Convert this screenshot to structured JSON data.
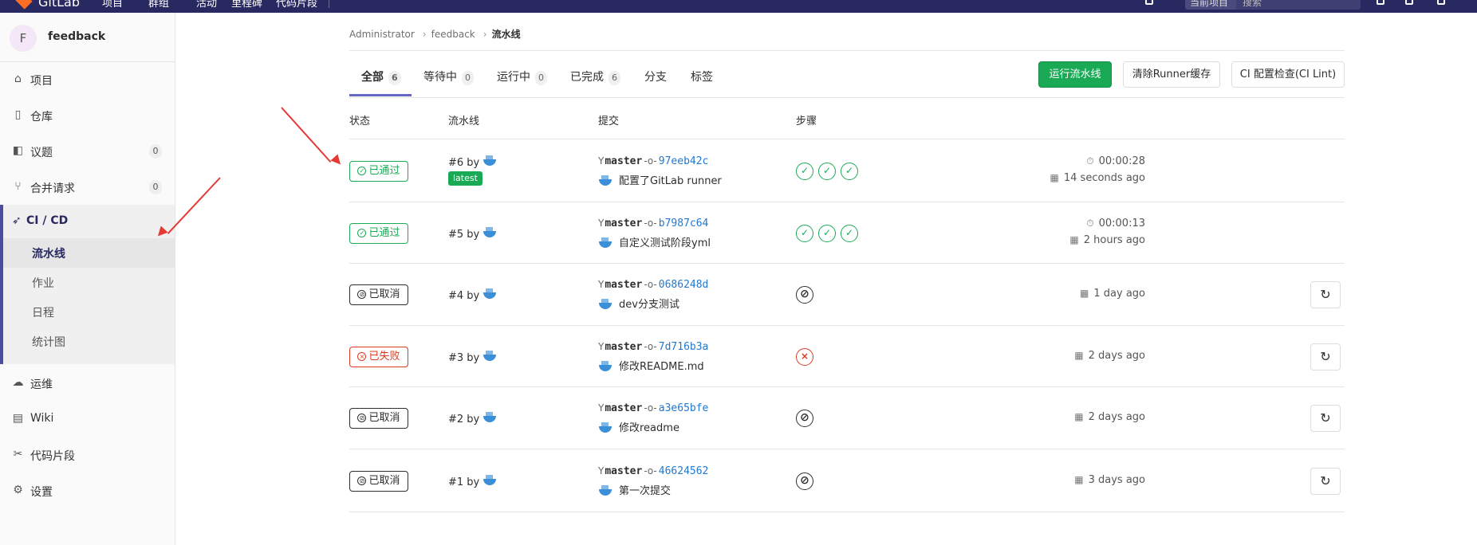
{
  "topbar": {
    "brand": "GitLab",
    "nav": [
      "项目",
      "群组",
      "活动",
      "里程碑",
      "代码片段"
    ],
    "scope": "当前项目",
    "search_placeholder": "搜索"
  },
  "sidebar": {
    "project_avatar": "F",
    "project_name": "feedback",
    "items": [
      {
        "label": "项目",
        "icon": "home-icon",
        "glyph": "⌂"
      },
      {
        "label": "仓库",
        "icon": "book-icon",
        "glyph": "▯"
      },
      {
        "label": "议题",
        "icon": "issues-icon",
        "glyph": "◧",
        "count": "0"
      },
      {
        "label": "合并请求",
        "icon": "merge-request-icon",
        "glyph": "⑂",
        "count": "0"
      },
      {
        "label": "运维",
        "icon": "cloud-icon",
        "glyph": "☁"
      },
      {
        "label": "Wiki",
        "icon": "wiki-icon",
        "glyph": "▤"
      },
      {
        "label": "代码片段",
        "icon": "snippet-icon",
        "glyph": "✂"
      },
      {
        "label": "设置",
        "icon": "settings-icon",
        "glyph": "⚙"
      }
    ],
    "cicd": {
      "label": "CI / CD",
      "glyph": "🚀",
      "sub": [
        "流水线",
        "作业",
        "日程",
        "统计图"
      ]
    }
  },
  "breadcrumb": [
    "Administrator",
    "feedback",
    "流水线"
  ],
  "tabs": [
    {
      "label": "全部",
      "count": "6"
    },
    {
      "label": "等待中",
      "count": "0"
    },
    {
      "label": "运行中",
      "count": "0"
    },
    {
      "label": "已完成",
      "count": "6"
    },
    {
      "label": "分支"
    },
    {
      "label": "标签"
    }
  ],
  "buttons": {
    "run_pipeline": "运行流水线",
    "clear_cache": "清除Runner缓存",
    "ci_lint": "CI 配置检查(CI Lint)"
  },
  "table_headers": [
    "状态",
    "流水线",
    "提交",
    "步骤"
  ],
  "pipelines": [
    {
      "status": "已通过",
      "kind": "passed",
      "id": "#6 by",
      "latest": "latest",
      "branch": "master",
      "sha": "97eeb42c",
      "message": "配置了GitLab runner",
      "stages": [
        "ok",
        "ok",
        "ok"
      ],
      "duration": "00:00:28",
      "finished": "14 seconds ago"
    },
    {
      "status": "已通过",
      "kind": "passed",
      "id": "#5 by",
      "branch": "master",
      "sha": "b7987c64",
      "message": "自定义测试阶段yml",
      "stages": [
        "ok",
        "ok",
        "ok"
      ],
      "duration": "00:00:13",
      "finished": "2 hours ago"
    },
    {
      "status": "已取消",
      "kind": "canceled",
      "id": "#4 by",
      "branch": "master",
      "sha": "0686248d",
      "message": "dev分支测试",
      "stages": [
        "cancel"
      ],
      "finished": "1 day ago",
      "retry": true
    },
    {
      "status": "已失败",
      "kind": "failed",
      "id": "#3 by",
      "branch": "master",
      "sha": "7d716b3a",
      "message": "修改README.md",
      "stages": [
        "fail"
      ],
      "finished": "2 days ago",
      "retry": true
    },
    {
      "status": "已取消",
      "kind": "canceled",
      "id": "#2 by",
      "branch": "master",
      "sha": "a3e65bfe",
      "message": "修改readme",
      "stages": [
        "cancel"
      ],
      "finished": "2 days ago",
      "retry": true
    },
    {
      "status": "已取消",
      "kind": "canceled",
      "id": "#1 by",
      "branch": "master",
      "sha": "46624562",
      "message": "第一次提交",
      "stages": [
        "cancel"
      ],
      "finished": "3 days ago",
      "retry": true
    }
  ],
  "colors": {
    "success": "#1aaa55",
    "danger": "#db3b21",
    "nav": "#292961",
    "annotation": "#e53935"
  }
}
